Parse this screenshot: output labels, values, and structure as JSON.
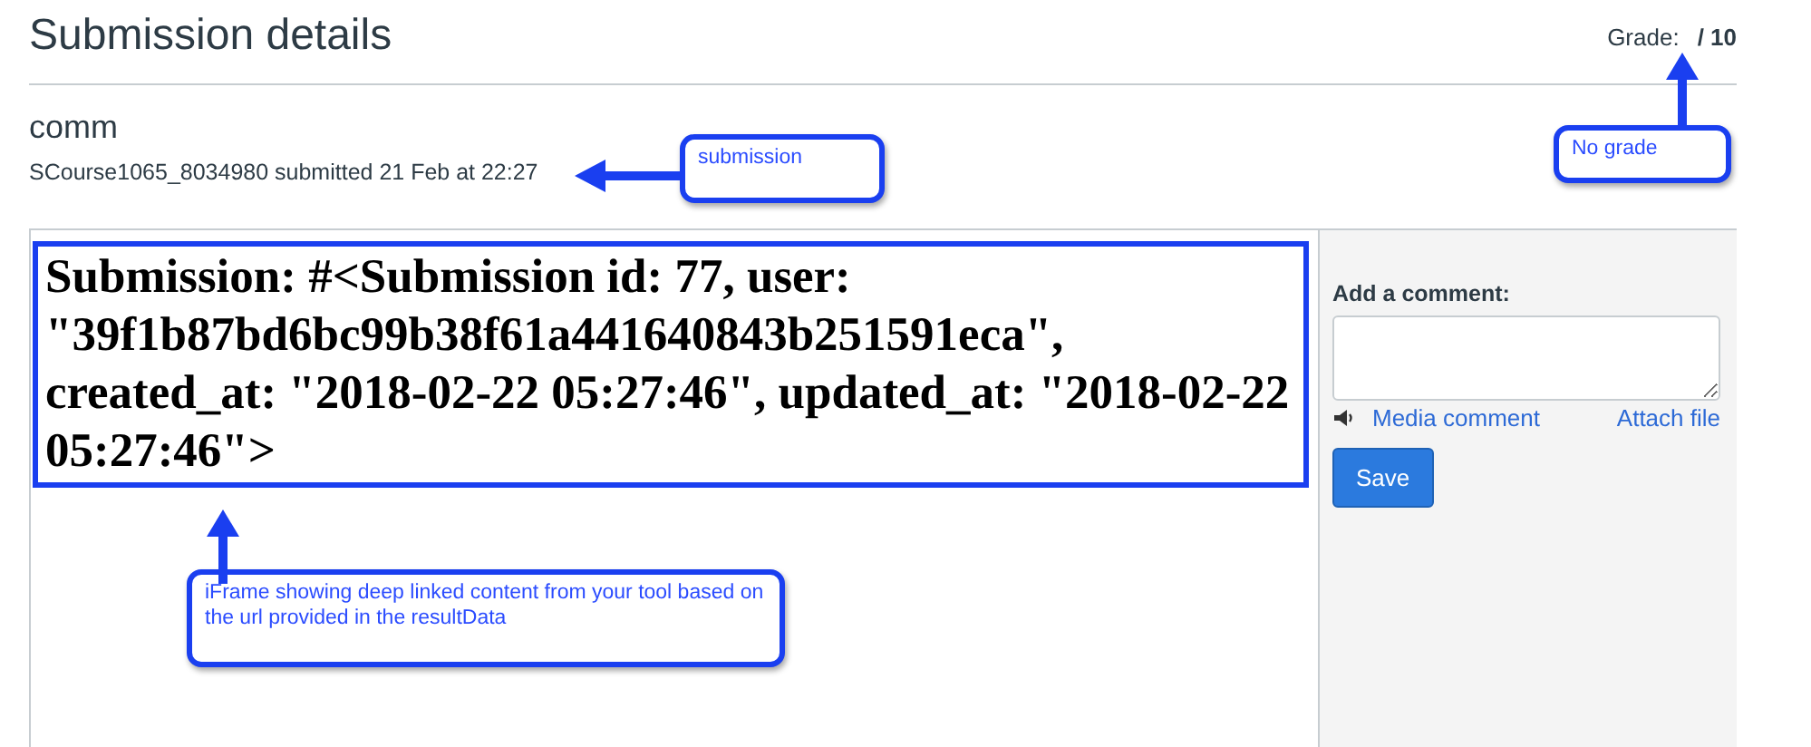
{
  "header": {
    "title": "Submission details",
    "grade_label": "Grade:",
    "grade_value": "/ 10"
  },
  "submission": {
    "assignment": "comm",
    "meta": "SCourse1065_8034980 submitted 21 Feb at 22:27"
  },
  "iframe": {
    "content": "Submission: #<Submission id: 77, user: \"39f1b87bd6bc99b38f61a441640843b251591eca\", created_at: \"2018-02-22 05:27:46\", updated_at: \"2018-02-22 05:27:46\">"
  },
  "comment_panel": {
    "label": "Add a comment:",
    "media_comment": "Media comment",
    "attach_file": "Attach file",
    "save": "Save"
  },
  "annotations": [
    {
      "text": "submission",
      "kind": "left"
    },
    {
      "text": "No grade",
      "kind": "up"
    },
    {
      "text": "iFrame showing deep linked content from your tool based on the url provided in the resultData",
      "kind": "up"
    }
  ]
}
